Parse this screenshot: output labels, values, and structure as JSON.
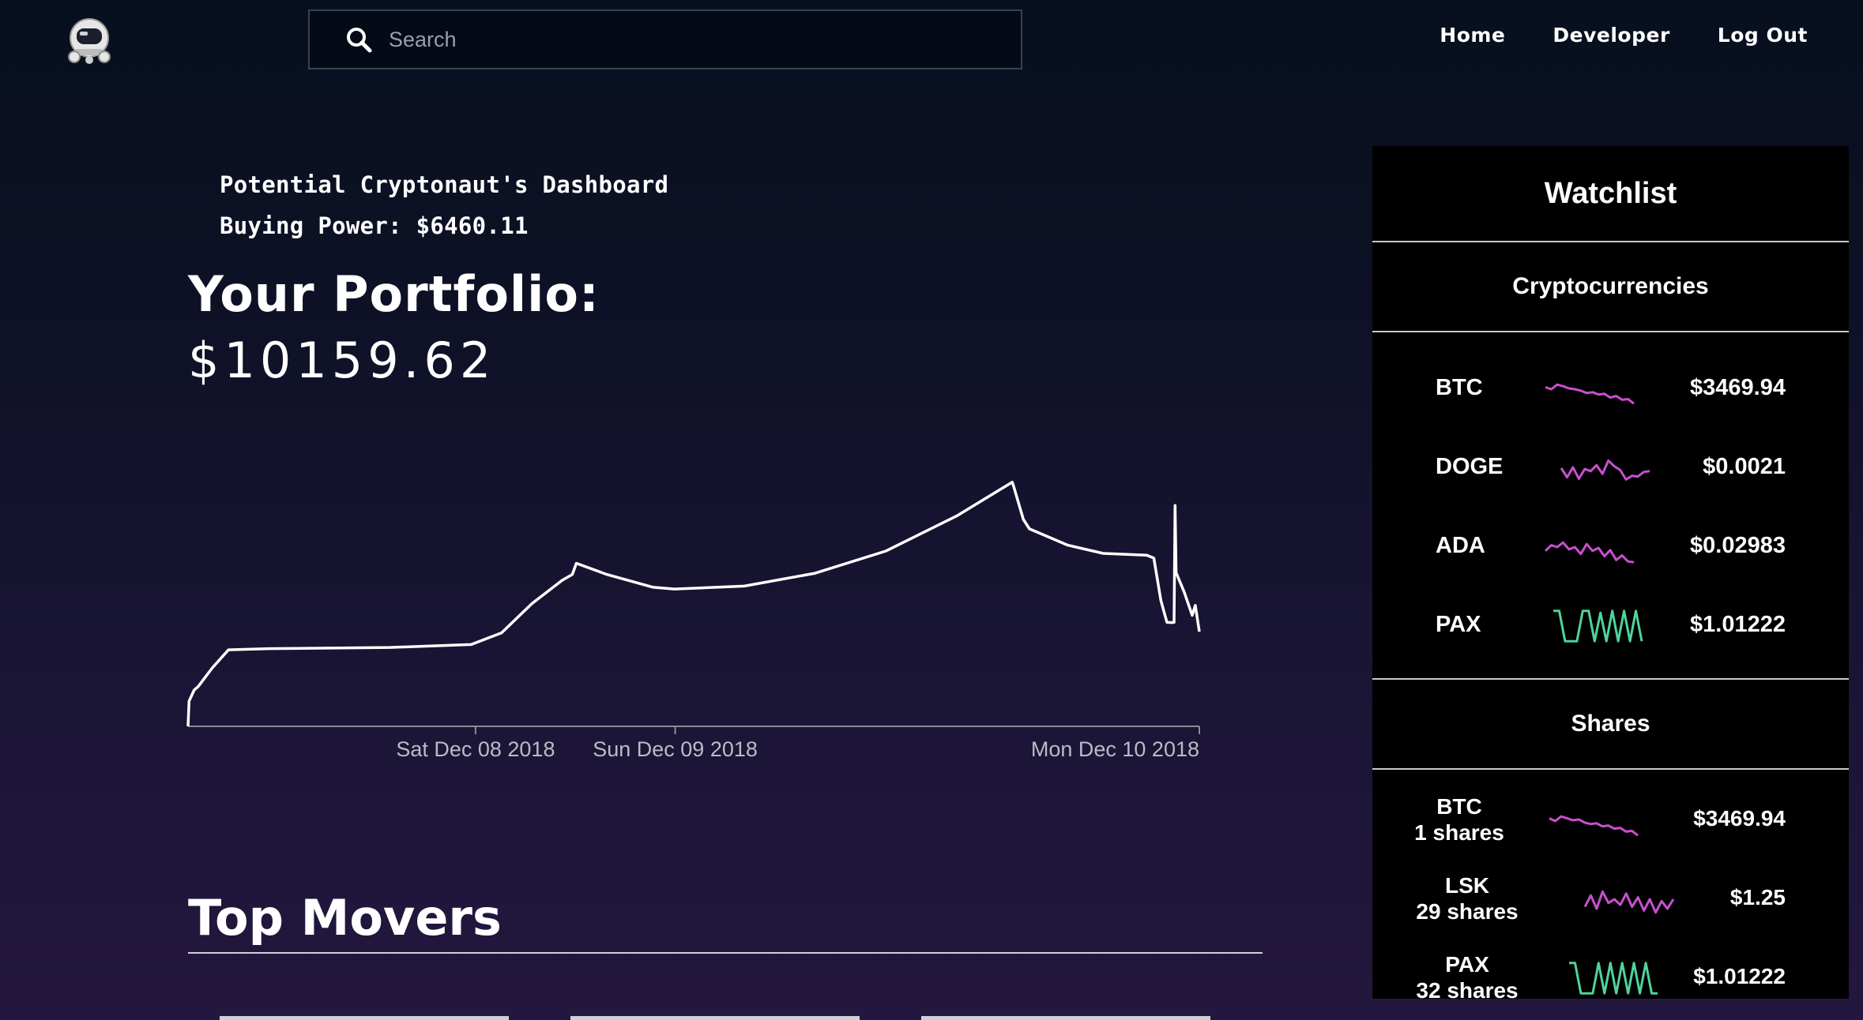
{
  "nav": {
    "logo_icon": "astronaut-helmet-icon",
    "search_placeholder": "Search",
    "search_icon": "search-icon",
    "links": [
      "Home",
      "Developer",
      "Log Out"
    ]
  },
  "dashboard": {
    "welcome": "Potential Cryptonaut's Dashboard",
    "buying_power": "Buying Power: $6460.11",
    "portfolio_title": "Your Portfolio:",
    "portfolio_value": "$10159.62"
  },
  "chart_data": {
    "type": "line",
    "title": "",
    "xlabel": "",
    "ylabel": "",
    "x_tick_labels": [
      "Sat Dec 08 2018",
      "Sun Dec 09 2018",
      "Mon Dec 10 2018"
    ],
    "x_ticks_at": [
      0.2843,
      0.4817,
      1.0
    ],
    "values": [
      [
        0.0,
        0.0
      ],
      [
        0.001,
        0.086
      ],
      [
        0.006,
        0.124
      ],
      [
        0.01,
        0.136
      ],
      [
        0.024,
        0.2
      ],
      [
        0.04,
        0.262
      ],
      [
        0.08,
        0.266
      ],
      [
        0.2,
        0.27
      ],
      [
        0.28,
        0.28
      ],
      [
        0.31,
        0.32
      ],
      [
        0.34,
        0.42
      ],
      [
        0.37,
        0.5
      ],
      [
        0.38,
        0.52
      ],
      [
        0.384,
        0.558
      ],
      [
        0.414,
        0.52
      ],
      [
        0.46,
        0.476
      ],
      [
        0.481,
        0.47
      ],
      [
        0.55,
        0.48
      ],
      [
        0.62,
        0.524
      ],
      [
        0.69,
        0.6
      ],
      [
        0.76,
        0.72
      ],
      [
        0.815,
        0.836
      ],
      [
        0.816,
        0.826
      ],
      [
        0.826,
        0.708
      ],
      [
        0.832,
        0.676
      ],
      [
        0.87,
        0.62
      ],
      [
        0.905,
        0.592
      ],
      [
        0.948,
        0.586
      ],
      [
        0.955,
        0.576
      ],
      [
        0.962,
        0.43
      ],
      [
        0.968,
        0.356
      ],
      [
        0.973,
        0.355
      ],
      [
        0.975,
        0.356
      ],
      [
        0.976,
        0.756
      ],
      [
        0.977,
        0.526
      ],
      [
        0.985,
        0.46
      ],
      [
        0.993,
        0.38
      ],
      [
        0.996,
        0.414
      ],
      [
        1.0,
        0.324
      ]
    ],
    "xlim": [
      0,
      1
    ],
    "ylim": [
      0,
      1
    ],
    "line_color": "#ffffff"
  },
  "top_movers": {
    "title": "Top Movers"
  },
  "watchlist": {
    "title": "Watchlist",
    "crypto_header": "Cryptocurrencies",
    "shares_header": "Shares",
    "cryptos": [
      {
        "symbol": "BTC",
        "price": "$3469.94",
        "color": "#c94fcf",
        "spark": [
          0.55,
          0.5,
          0.62,
          0.58,
          0.52,
          0.5,
          0.46,
          0.4,
          0.42,
          0.36,
          0.38,
          0.28,
          0.32,
          0.22,
          0.24,
          0.12
        ]
      },
      {
        "symbol": "DOGE",
        "price": "$0.0021",
        "color": "#c94fcf",
        "spark": [
          0.5,
          0.26,
          0.52,
          0.22,
          0.48,
          0.42,
          0.58,
          0.35,
          0.7,
          0.55,
          0.45,
          0.2,
          0.3,
          0.28,
          0.4,
          0.42
        ]
      },
      {
        "symbol": "ADA",
        "price": "$0.02983",
        "color": "#c94fcf",
        "spark": [
          0.4,
          0.55,
          0.5,
          0.62,
          0.44,
          0.5,
          0.32,
          0.58,
          0.4,
          0.48,
          0.26,
          0.42,
          0.16,
          0.28,
          0.12,
          0.1
        ]
      },
      {
        "symbol": "PAX",
        "price": "$1.01222",
        "color": "#4fd39a",
        "spark": [
          0.9,
          0.9,
          0.1,
          0.1,
          0.1,
          0.9,
          0.9,
          0.1,
          0.85,
          0.1,
          0.9,
          0.1,
          0.9,
          0.1,
          0.9,
          0.1
        ]
      }
    ],
    "shares": [
      {
        "symbol": "BTC",
        "shares": "1 shares",
        "price": "$3469.94",
        "color": "#c94fcf",
        "spark": [
          0.55,
          0.48,
          0.6,
          0.55,
          0.5,
          0.52,
          0.44,
          0.4,
          0.42,
          0.34,
          0.36,
          0.28,
          0.3,
          0.2,
          0.22,
          0.1
        ]
      },
      {
        "symbol": "LSK",
        "shares": "29 shares",
        "price": "$1.25",
        "color": "#c94fcf",
        "spark": [
          0.3,
          0.6,
          0.25,
          0.7,
          0.4,
          0.5,
          0.35,
          0.65,
          0.3,
          0.55,
          0.2,
          0.5,
          0.15,
          0.45,
          0.25,
          0.5
        ]
      },
      {
        "symbol": "PAX",
        "shares": "32 shares",
        "price": "$1.01222",
        "color": "#4fd39a",
        "spark": [
          0.9,
          0.9,
          0.1,
          0.1,
          0.1,
          0.9,
          0.1,
          0.9,
          0.1,
          0.9,
          0.1,
          0.9,
          0.1,
          0.9,
          0.1,
          0.1
        ]
      }
    ]
  }
}
